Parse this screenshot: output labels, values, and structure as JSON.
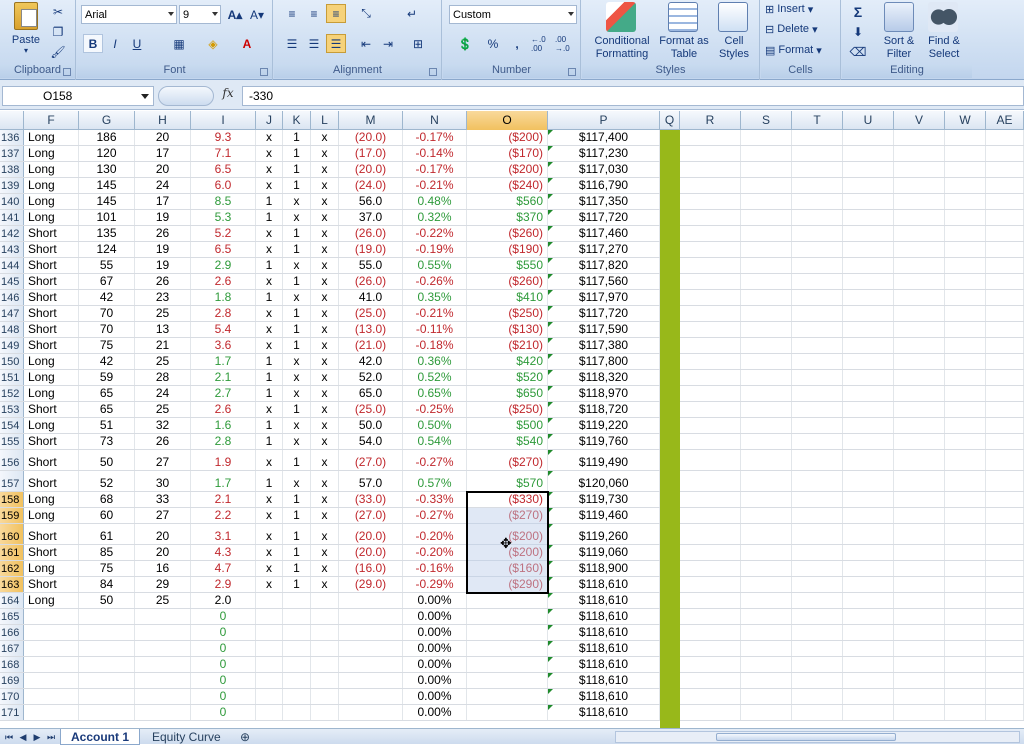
{
  "ribbon": {
    "clipboard": {
      "label": "Clipboard",
      "paste": "Paste"
    },
    "font": {
      "label": "Font",
      "name": "Arial",
      "size": "9",
      "bold": "B",
      "italic": "I",
      "underline": "U"
    },
    "alignment": {
      "label": "Alignment"
    },
    "number": {
      "label": "Number",
      "format": "Custom",
      "percent": "%",
      "comma": ",",
      "inc_decimal": "←.0 .00",
      "dec_decimal": ".00 →.0"
    },
    "styles": {
      "label": "Styles",
      "conditional": "Conditional Formatting",
      "format_table": "Format as Table",
      "cell_styles": "Cell Styles"
    },
    "cells": {
      "label": "Cells",
      "insert": "Insert",
      "delete": "Delete",
      "format": "Format"
    },
    "editing": {
      "label": "Editing",
      "sum": "Σ",
      "sort_filter": "Sort & Filter",
      "find_select": "Find & Select"
    }
  },
  "formula_bar": {
    "name_box": "O158",
    "fx": "fx",
    "content": "-330"
  },
  "columns": [
    "F",
    "G",
    "H",
    "I",
    "J",
    "K",
    "L",
    "M",
    "N",
    "O",
    "P",
    "Q",
    "R",
    "S",
    "T",
    "U",
    "V",
    "W",
    "AE"
  ],
  "selected_column": "O",
  "rows": [
    {
      "n": "136",
      "F": "Long",
      "G": "186",
      "H": "20",
      "I": "9.3",
      "J": "x",
      "K": "1",
      "L": "x",
      "M": "(20.0)",
      "N": "-0.17%",
      "O": "($200)",
      "P": "$117,400"
    },
    {
      "n": "137",
      "F": "Long",
      "G": "120",
      "H": "17",
      "I": "7.1",
      "J": "x",
      "K": "1",
      "L": "x",
      "M": "(17.0)",
      "N": "-0.14%",
      "O": "($170)",
      "P": "$117,230"
    },
    {
      "n": "138",
      "F": "Long",
      "G": "130",
      "H": "20",
      "I": "6.5",
      "J": "x",
      "K": "1",
      "L": "x",
      "M": "(20.0)",
      "N": "-0.17%",
      "O": "($200)",
      "P": "$117,030"
    },
    {
      "n": "139",
      "F": "Long",
      "G": "145",
      "H": "24",
      "I": "6.0",
      "J": "x",
      "K": "1",
      "L": "x",
      "M": "(24.0)",
      "N": "-0.21%",
      "O": "($240)",
      "P": "$116,790"
    },
    {
      "n": "140",
      "F": "Long",
      "G": "145",
      "H": "17",
      "I": "8.5",
      "J": "1",
      "K": "x",
      "L": "x",
      "M": "56.0",
      "N": "0.48%",
      "O": "$560",
      "P": "$117,350"
    },
    {
      "n": "141",
      "F": "Long",
      "G": "101",
      "H": "19",
      "I": "5.3",
      "J": "1",
      "K": "x",
      "L": "x",
      "M": "37.0",
      "N": "0.32%",
      "O": "$370",
      "P": "$117,720"
    },
    {
      "n": "142",
      "F": "Short",
      "G": "135",
      "H": "26",
      "I": "5.2",
      "J": "x",
      "K": "1",
      "L": "x",
      "M": "(26.0)",
      "N": "-0.22%",
      "O": "($260)",
      "P": "$117,460"
    },
    {
      "n": "143",
      "F": "Short",
      "G": "124",
      "H": "19",
      "I": "6.5",
      "J": "x",
      "K": "1",
      "L": "x",
      "M": "(19.0)",
      "N": "-0.19%",
      "O": "($190)",
      "P": "$117,270"
    },
    {
      "n": "144",
      "F": "Short",
      "G": "55",
      "H": "19",
      "I": "2.9",
      "J": "1",
      "K": "x",
      "L": "x",
      "M": "55.0",
      "N": "0.55%",
      "O": "$550",
      "P": "$117,820"
    },
    {
      "n": "145",
      "F": "Short",
      "G": "67",
      "H": "26",
      "I": "2.6",
      "J": "x",
      "K": "1",
      "L": "x",
      "M": "(26.0)",
      "N": "-0.26%",
      "O": "($260)",
      "P": "$117,560"
    },
    {
      "n": "146",
      "F": "Short",
      "G": "42",
      "H": "23",
      "I": "1.8",
      "J": "1",
      "K": "x",
      "L": "x",
      "M": "41.0",
      "N": "0.35%",
      "O": "$410",
      "P": "$117,970"
    },
    {
      "n": "147",
      "F": "Short",
      "G": "70",
      "H": "25",
      "I": "2.8",
      "J": "x",
      "K": "1",
      "L": "x",
      "M": "(25.0)",
      "N": "-0.21%",
      "O": "($250)",
      "P": "$117,720"
    },
    {
      "n": "148",
      "F": "Short",
      "G": "70",
      "H": "13",
      "I": "5.4",
      "J": "x",
      "K": "1",
      "L": "x",
      "M": "(13.0)",
      "N": "-0.11%",
      "O": "($130)",
      "P": "$117,590"
    },
    {
      "n": "149",
      "F": "Short",
      "G": "75",
      "H": "21",
      "I": "3.6",
      "J": "x",
      "K": "1",
      "L": "x",
      "M": "(21.0)",
      "N": "-0.18%",
      "O": "($210)",
      "P": "$117,380"
    },
    {
      "n": "150",
      "F": "Long",
      "G": "42",
      "H": "25",
      "I": "1.7",
      "J": "1",
      "K": "x",
      "L": "x",
      "M": "42.0",
      "N": "0.36%",
      "O": "$420",
      "P": "$117,800"
    },
    {
      "n": "151",
      "F": "Long",
      "G": "59",
      "H": "28",
      "I": "2.1",
      "J": "1",
      "K": "x",
      "L": "x",
      "M": "52.0",
      "N": "0.52%",
      "O": "$520",
      "P": "$118,320"
    },
    {
      "n": "152",
      "F": "Long",
      "G": "65",
      "H": "24",
      "I": "2.7",
      "J": "1",
      "K": "x",
      "L": "x",
      "M": "65.0",
      "N": "0.65%",
      "O": "$650",
      "P": "$118,970"
    },
    {
      "n": "153",
      "F": "Short",
      "G": "65",
      "H": "25",
      "I": "2.6",
      "J": "x",
      "K": "1",
      "L": "x",
      "M": "(25.0)",
      "N": "-0.25%",
      "O": "($250)",
      "P": "$118,720"
    },
    {
      "n": "154",
      "F": "Long",
      "G": "51",
      "H": "32",
      "I": "1.6",
      "J": "1",
      "K": "x",
      "L": "x",
      "M": "50.0",
      "N": "0.50%",
      "O": "$500",
      "P": "$119,220"
    },
    {
      "n": "155",
      "F": "Short",
      "G": "73",
      "H": "26",
      "I": "2.8",
      "J": "1",
      "K": "x",
      "L": "x",
      "M": "54.0",
      "N": "0.54%",
      "O": "$540",
      "P": "$119,760"
    },
    {
      "n": "156",
      "F": "Short",
      "G": "50",
      "H": "27",
      "I": "1.9",
      "J": "x",
      "K": "1",
      "L": "x",
      "M": "(27.0)",
      "N": "-0.27%",
      "O": "($270)",
      "P": "$119,490"
    },
    {
      "n": "157",
      "F": "Short",
      "G": "52",
      "H": "30",
      "I": "1.7",
      "J": "1",
      "K": "x",
      "L": "x",
      "M": "57.0",
      "N": "0.57%",
      "O": "$570",
      "P": "$120,060"
    },
    {
      "n": "158",
      "F": "Long",
      "G": "68",
      "H": "33",
      "I": "2.1",
      "J": "x",
      "K": "1",
      "L": "x",
      "M": "(33.0)",
      "N": "-0.33%",
      "O": "($330)",
      "P": "$119,730"
    },
    {
      "n": "159",
      "F": "Long",
      "G": "60",
      "H": "27",
      "I": "2.2",
      "J": "x",
      "K": "1",
      "L": "x",
      "M": "(27.0)",
      "N": "-0.27%",
      "O": "($270)",
      "P": "$119,460"
    },
    {
      "n": "160",
      "F": "Short",
      "G": "61",
      "H": "20",
      "I": "3.1",
      "J": "x",
      "K": "1",
      "L": "x",
      "M": "(20.0)",
      "N": "-0.20%",
      "O": "($200)",
      "P": "$119,260"
    },
    {
      "n": "161",
      "F": "Short",
      "G": "85",
      "H": "20",
      "I": "4.3",
      "J": "x",
      "K": "1",
      "L": "x",
      "M": "(20.0)",
      "N": "-0.20%",
      "O": "($200)",
      "P": "$119,060"
    },
    {
      "n": "162",
      "F": "Long",
      "G": "75",
      "H": "16",
      "I": "4.7",
      "J": "x",
      "K": "1",
      "L": "x",
      "M": "(16.0)",
      "N": "-0.16%",
      "O": "($160)",
      "P": "$118,900"
    },
    {
      "n": "163",
      "F": "Short",
      "G": "84",
      "H": "29",
      "I": "2.9",
      "J": "x",
      "K": "1",
      "L": "x",
      "M": "(29.0)",
      "N": "-0.29%",
      "O": "($290)",
      "P": "$118,610"
    },
    {
      "n": "164",
      "F": "Long",
      "G": "50",
      "H": "25",
      "I": "2.0",
      "J": "",
      "K": "",
      "L": "",
      "M": "",
      "N": "0.00%",
      "O": "",
      "P": "$118,610"
    },
    {
      "n": "165",
      "F": "",
      "G": "",
      "H": "",
      "I": "0",
      "J": "",
      "K": "",
      "L": "",
      "M": "",
      "N": "0.00%",
      "O": "",
      "P": "$118,610"
    },
    {
      "n": "166",
      "F": "",
      "G": "",
      "H": "",
      "I": "0",
      "J": "",
      "K": "",
      "L": "",
      "M": "",
      "N": "0.00%",
      "O": "",
      "P": "$118,610"
    },
    {
      "n": "167",
      "F": "",
      "G": "",
      "H": "",
      "I": "0",
      "J": "",
      "K": "",
      "L": "",
      "M": "",
      "N": "0.00%",
      "O": "",
      "P": "$118,610"
    },
    {
      "n": "168",
      "F": "",
      "G": "",
      "H": "",
      "I": "0",
      "J": "",
      "K": "",
      "L": "",
      "M": "",
      "N": "0.00%",
      "O": "",
      "P": "$118,610"
    },
    {
      "n": "169",
      "F": "",
      "G": "",
      "H": "",
      "I": "0",
      "J": "",
      "K": "",
      "L": "",
      "M": "",
      "N": "0.00%",
      "O": "",
      "P": "$118,610"
    },
    {
      "n": "170",
      "F": "",
      "G": "",
      "H": "",
      "I": "0",
      "J": "",
      "K": "",
      "L": "",
      "M": "",
      "N": "0.00%",
      "O": "",
      "P": "$118,610"
    },
    {
      "n": "171",
      "F": "",
      "G": "",
      "H": "",
      "I": "0",
      "J": "",
      "K": "",
      "L": "",
      "M": "",
      "N": "0.00%",
      "O": "",
      "P": "$118,610"
    }
  ],
  "selected_rows": [
    "158",
    "159",
    "160",
    "161",
    "162",
    "163"
  ],
  "sheet_tabs": [
    "Account 1",
    "Equity Curve"
  ],
  "active_tab": "Account 1",
  "colors": {
    "positive": "#2e9a3a",
    "negative": "#c0282d",
    "q_column": "#98b81a",
    "selection_header": "#f1c15f"
  }
}
